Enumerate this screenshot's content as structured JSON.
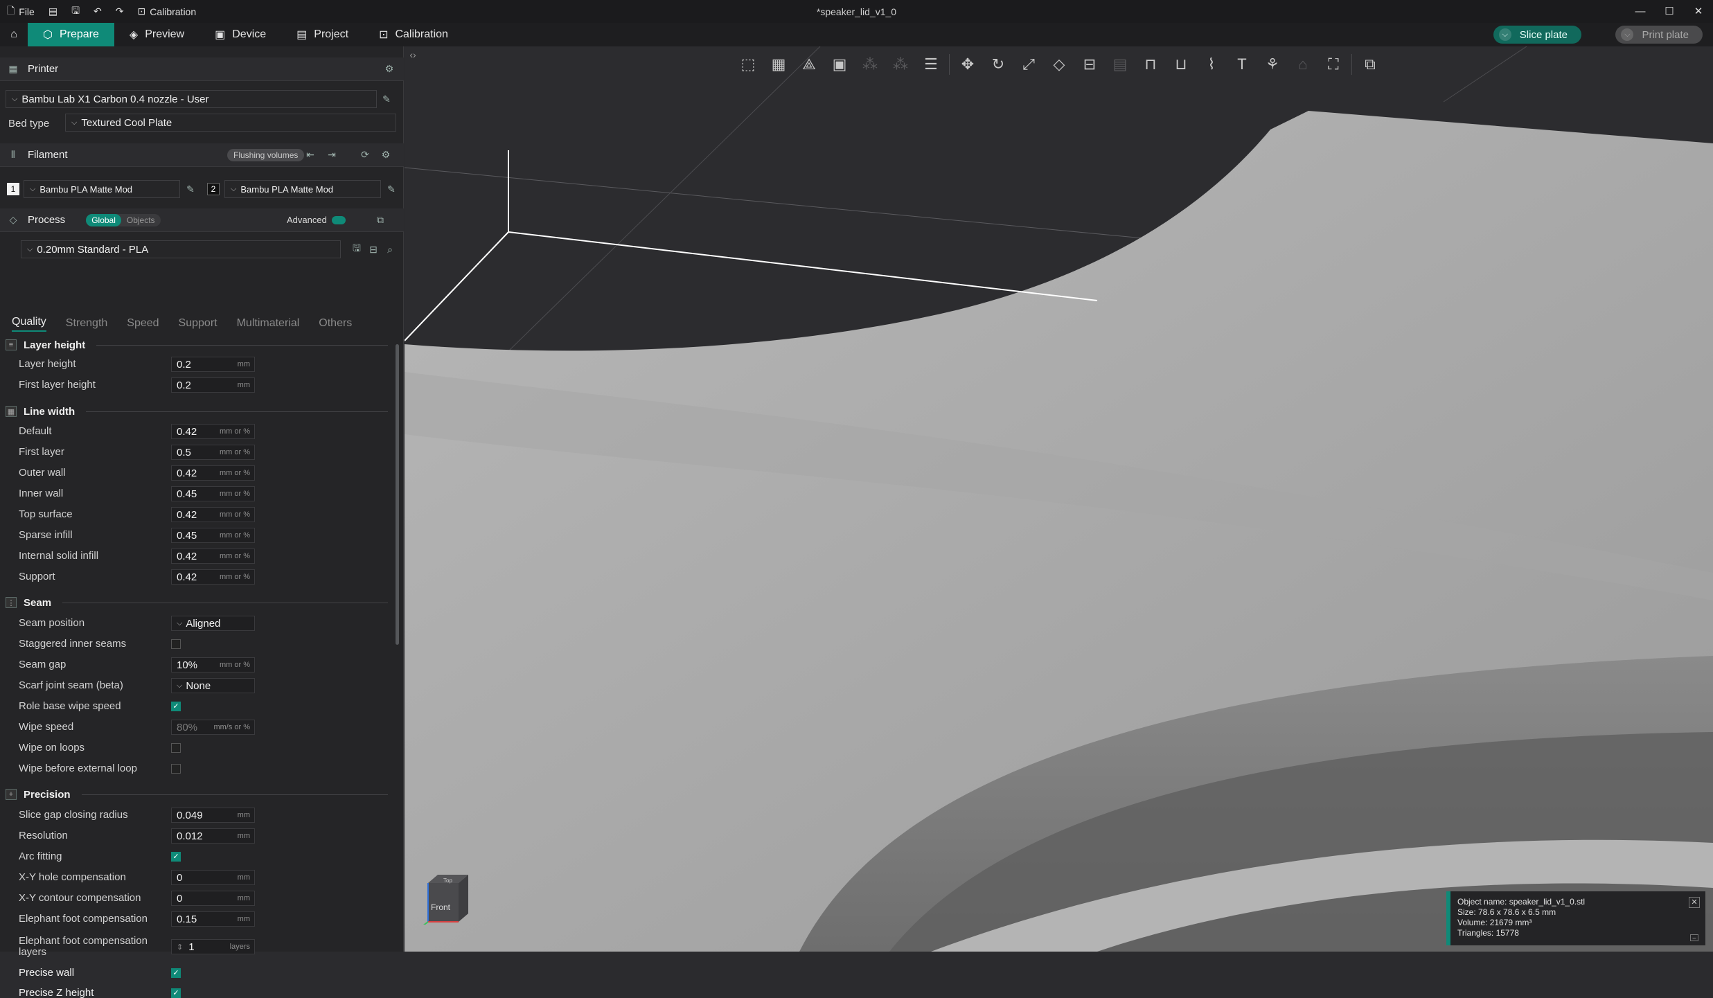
{
  "titlebar": {
    "file_label": "File",
    "calibration_label": "Calibration",
    "doc_title": "*speaker_lid_v1_0",
    "icons": [
      "file-icon",
      "notes-icon",
      "save-icon",
      "undo-icon",
      "redo-icon",
      "calibration-icon"
    ],
    "window": {
      "minimize": "—",
      "maximize": "☐",
      "close": "✕"
    }
  },
  "tabs": [
    {
      "label": "Prepare",
      "active": true
    },
    {
      "label": "Preview"
    },
    {
      "label": "Device"
    },
    {
      "label": "Project"
    },
    {
      "label": "Calibration"
    }
  ],
  "actions": {
    "slice": "Slice plate",
    "print": "Print plate"
  },
  "printer": {
    "section": "Printer",
    "preset": "Bambu Lab X1 Carbon 0.4 nozzle - User",
    "bed_type_label": "Bed type",
    "bed_type": "Textured Cool Plate"
  },
  "filament": {
    "section": "Filament",
    "flushing": "Flushing volumes",
    "slots": [
      {
        "num": "1",
        "name": "Bambu PLA Matte Mod"
      },
      {
        "num": "2",
        "name": "Bambu PLA Matte Mod"
      }
    ]
  },
  "process": {
    "section": "Process",
    "global": "Global",
    "objects": "Objects",
    "advanced": "Advanced",
    "preset": "0.20mm Standard - PLA",
    "tabs": [
      "Quality",
      "Strength",
      "Speed",
      "Support",
      "Multimaterial",
      "Others"
    ]
  },
  "groups": {
    "layer_height": "Layer height",
    "line_width": "Line width",
    "seam": "Seam",
    "precision": "Precision"
  },
  "rows": {
    "layer_height": {
      "label": "Layer height",
      "value": "0.2",
      "unit": "mm"
    },
    "first_layer_height": {
      "label": "First layer height",
      "value": "0.2",
      "unit": "mm"
    },
    "lw_default": {
      "label": "Default",
      "value": "0.42",
      "unit": "mm or %"
    },
    "lw_first": {
      "label": "First layer",
      "value": "0.5",
      "unit": "mm or %"
    },
    "lw_outer": {
      "label": "Outer wall",
      "value": "0.42",
      "unit": "mm or %"
    },
    "lw_inner": {
      "label": "Inner wall",
      "value": "0.45",
      "unit": "mm or %"
    },
    "lw_top": {
      "label": "Top surface",
      "value": "0.42",
      "unit": "mm or %"
    },
    "lw_sparse": {
      "label": "Sparse infill",
      "value": "0.45",
      "unit": "mm or %"
    },
    "lw_internal": {
      "label": "Internal solid infill",
      "value": "0.42",
      "unit": "mm or %"
    },
    "lw_support": {
      "label": "Support",
      "value": "0.42",
      "unit": "mm or %"
    },
    "seam_position": {
      "label": "Seam position",
      "value": "Aligned"
    },
    "staggered": {
      "label": "Staggered inner seams",
      "checked": false
    },
    "seam_gap": {
      "label": "Seam gap",
      "value": "10%",
      "unit": "mm or %"
    },
    "scarf": {
      "label": "Scarf joint seam (beta)",
      "value": "None"
    },
    "role_wipe": {
      "label": "Role base wipe speed",
      "checked": true
    },
    "wipe_speed": {
      "label": "Wipe speed",
      "value": "80%",
      "unit": "mm/s or %"
    },
    "wipe_loops": {
      "label": "Wipe on loops",
      "checked": false
    },
    "wipe_before": {
      "label": "Wipe before external loop",
      "checked": false
    },
    "slice_gap": {
      "label": "Slice gap closing radius",
      "value": "0.049",
      "unit": "mm"
    },
    "resolution": {
      "label": "Resolution",
      "value": "0.012",
      "unit": "mm"
    },
    "arc_fitting": {
      "label": "Arc fitting",
      "checked": true
    },
    "xy_hole": {
      "label": "X-Y hole compensation",
      "value": "0",
      "unit": "mm"
    },
    "xy_contour": {
      "label": "X-Y contour compensation",
      "value": "0",
      "unit": "mm"
    },
    "elephant": {
      "label": "Elephant foot compensation",
      "value": "0.15",
      "unit": "mm"
    },
    "elephant_layers": {
      "label": "Elephant foot compensation layers",
      "value": "1",
      "unit": "layers"
    },
    "precise_wall": {
      "label": "Precise wall",
      "checked": true
    },
    "precise_z": {
      "label": "Precise Z height",
      "checked": true
    }
  },
  "object_info": {
    "name": "Object name: speaker_lid_v1_0.stl",
    "size": "Size: 78.6 x 78.6 x 6.5 mm",
    "volume": "Volume: 21679 mm³",
    "triangles": "Triangles: 15778"
  },
  "navcube": {
    "front": "Front",
    "top": "Top"
  }
}
